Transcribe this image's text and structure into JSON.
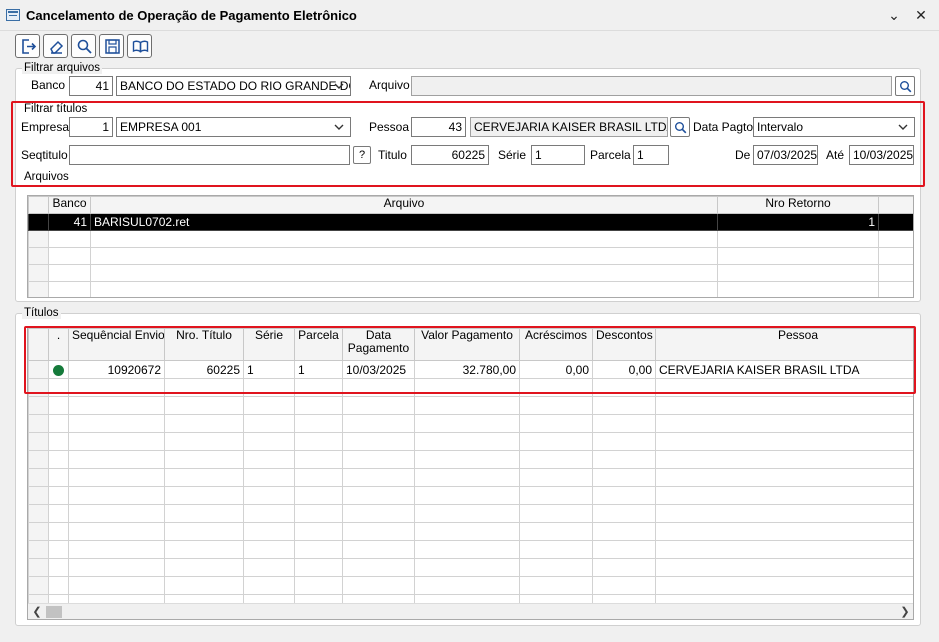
{
  "window": {
    "title": "Cancelamento de Operação de Pagamento Eletrônico",
    "minimize_glyph": "⌄",
    "close_glyph": "✕"
  },
  "toolbar": {
    "buttons": [
      {
        "icon": "exit-icon"
      },
      {
        "icon": "eraser-icon"
      },
      {
        "icon": "search-icon"
      },
      {
        "icon": "save-icon"
      },
      {
        "icon": "book-icon"
      }
    ]
  },
  "filtrar_arquivos": {
    "label": "Filtrar arquivos",
    "banco_label": "Banco",
    "banco_code": "41",
    "banco_name": "BANCO DO ESTADO DO RIO GRANDE DO",
    "arquivo_label": "Arquivo",
    "arquivo_value": ""
  },
  "filtrar_titulos": {
    "label": "Filtrar títulos",
    "empresa_label": "Empresa",
    "empresa_code": "1",
    "empresa_name": "EMPRESA 001",
    "pessoa_label": "Pessoa",
    "pessoa_code": "43",
    "pessoa_name": "CERVEJARIA KAISER BRASIL LTDA",
    "data_pagto_label": "Data Pagto.",
    "data_pagto_value": "Intervalo",
    "seqtitulo_label": "Seqtitulo",
    "seqtitulo_value": "",
    "help_glyph": "?",
    "titulo_label": "Titulo",
    "titulo_value": "60225",
    "serie_label": "Série",
    "serie_value": "1",
    "parcela_label": "Parcela",
    "parcela_value": "1",
    "de_label": "De",
    "de_value": "07/03/2025",
    "ate_label": "Até",
    "ate_value": "10/03/2025"
  },
  "arquivos": {
    "label": "Arquivos",
    "columns": [
      "Banco",
      "Arquivo",
      "Nro Retorno"
    ],
    "rows": [
      {
        "banco": "41",
        "arquivo": "BARISUL0702.ret",
        "nro_retorno": "1"
      }
    ]
  },
  "titulos": {
    "label": "Títulos",
    "columns": [
      ".",
      "Sequêncial Envio",
      "Nro. Título",
      "Série",
      "Parcela",
      "Data Pagamento",
      "Valor Pagamento",
      "Acréscimos",
      "Descontos",
      "Pessoa"
    ],
    "rows": [
      {
        "status_color": "#157a3a",
        "seq_envio": "10920672",
        "nro_titulo": "60225",
        "serie": "1",
        "parcela": "1",
        "data_pagamento": "10/03/2025",
        "valor_pagamento": "32.780,00",
        "acrescimos": "0,00",
        "descontos": "0,00",
        "pessoa": "CERVEJARIA KAISER BRASIL LTDA"
      }
    ]
  },
  "colors": {
    "highlight_border": "#e0141e",
    "selected_row": "#000000",
    "status_ok": "#157a3a"
  }
}
